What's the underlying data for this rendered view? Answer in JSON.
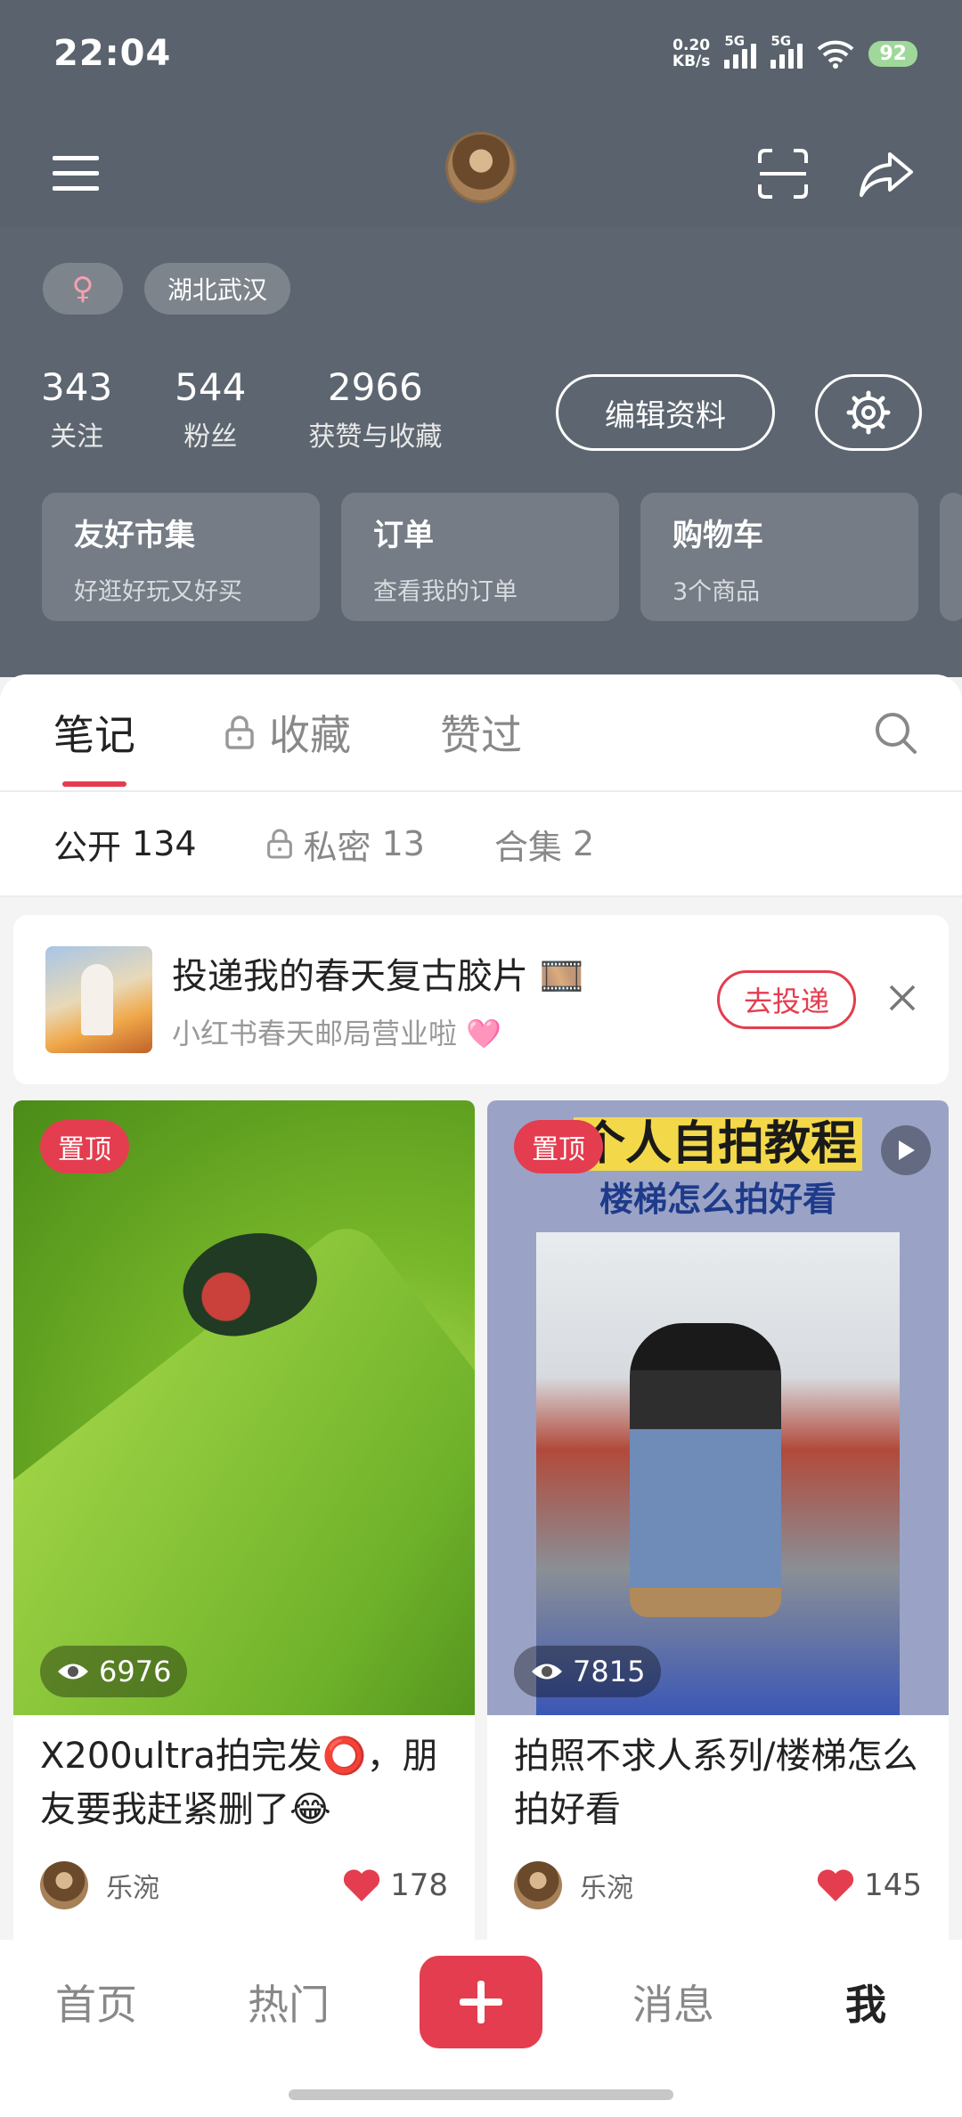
{
  "status": {
    "time": "22:04",
    "speed_top": "0.20",
    "speed_unit": "KB/s",
    "sig1": "5G",
    "sig2": "5G",
    "battery": "92"
  },
  "profile": {
    "gender_symbol": "♀",
    "location": "湖北武汉",
    "stats": [
      {
        "num": "343",
        "label": "关注"
      },
      {
        "num": "544",
        "label": "粉丝"
      },
      {
        "num": "2966",
        "label": "获赞与收藏"
      }
    ],
    "edit_label": "编辑资料"
  },
  "cards": [
    {
      "title": "友好市集",
      "sub": "好逛好玩又好买"
    },
    {
      "title": "订单",
      "sub": "查看我的订单"
    },
    {
      "title": "购物车",
      "sub": "3个商品"
    }
  ],
  "tabs": [
    {
      "label": "笔记"
    },
    {
      "label": "收藏"
    },
    {
      "label": "赞过"
    }
  ],
  "subtabs": [
    {
      "label": "公开",
      "count": "134"
    },
    {
      "label": "私密",
      "count": "13"
    },
    {
      "label": "合集",
      "count": "2"
    }
  ],
  "banner": {
    "title": "投递我的春天复古胶片 🎞️",
    "sub": "小红书春天邮局营业啦 🩷",
    "button": "去投递"
  },
  "notes": [
    {
      "pin": "置顶",
      "views": "6976",
      "title": "X200ultra拍完发⭕️，朋友要我赶紧删了😂",
      "author": "乐涴",
      "likes": "178"
    },
    {
      "pin": "置顶",
      "overlay_title": "个人自拍教程",
      "overlay_sub": "楼梯怎么拍好看",
      "views": "7815",
      "title": "拍照不求人系列/楼梯怎么拍好看",
      "author": "乐涴",
      "likes": "145"
    }
  ],
  "bottomnav": {
    "home": "首页",
    "hot": "热门",
    "messages": "消息",
    "me": "我"
  },
  "colors": {
    "accent": "#e43d4f",
    "header_bg": "#5d6670"
  }
}
